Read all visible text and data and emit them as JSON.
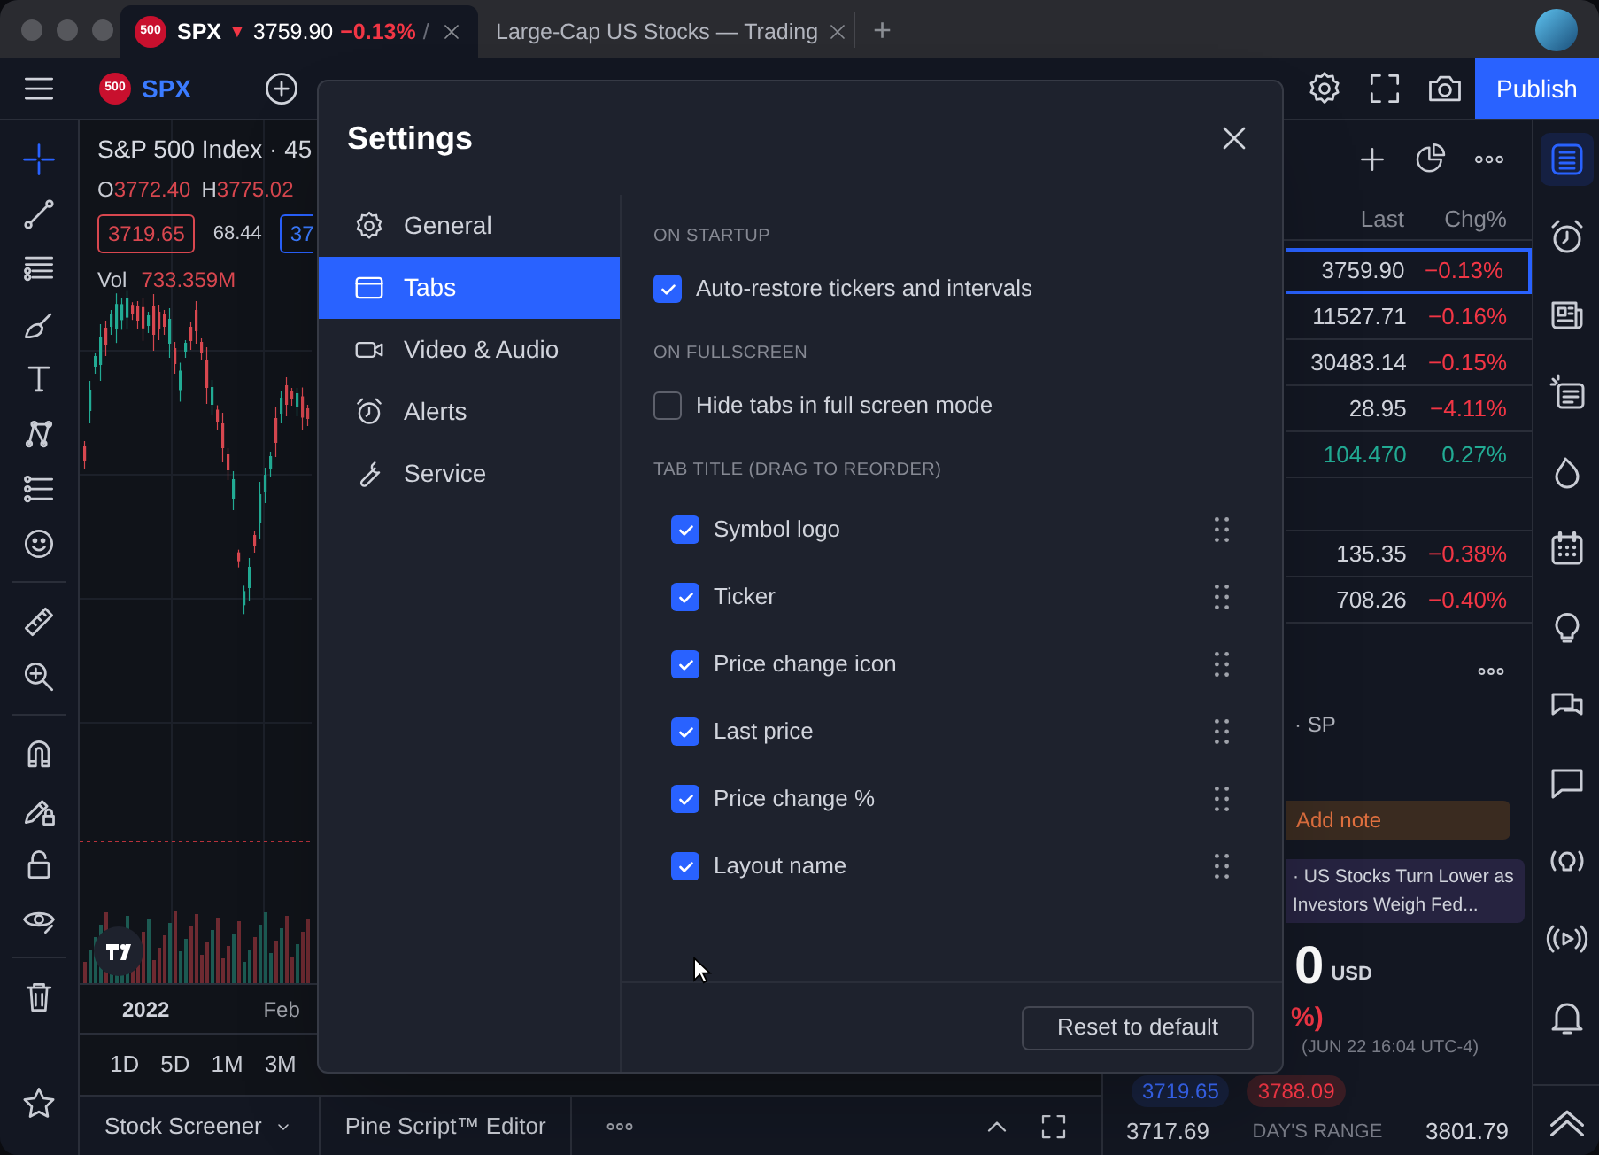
{
  "browser_tabs": [
    {
      "kind": "symbol",
      "logo": "500",
      "symbol": "SPX",
      "arrow": "▼",
      "price": "3759.90",
      "change": "−0.13%",
      "separator": "/",
      "selected": true
    },
    {
      "kind": "page",
      "title": "Large-Cap US Stocks — Trading",
      "selected": false
    }
  ],
  "new_tab": "+",
  "toolbar": {
    "logo": "500",
    "symbol": "SPX",
    "publish": "Publish"
  },
  "left_toolbar": {
    "tools": [
      {
        "selected": true
      },
      {
        "selected": false
      },
      {
        "selected": false
      },
      {
        "selected": false
      },
      {
        "selected": false
      },
      {
        "selected": false
      },
      {
        "selected": false
      },
      {
        "selected": false
      },
      {
        "selected": false
      },
      {
        "selected": false
      },
      {
        "selected": false
      },
      {
        "selected": false
      },
      {
        "selected": false
      },
      {
        "selected": false
      },
      {
        "selected": false
      },
      {
        "selected": false
      }
    ]
  },
  "chart": {
    "title": "S&P 500 Index · 45",
    "ohlc": [
      {
        "label": "O",
        "value": "3772.40"
      },
      {
        "label": "H",
        "value": "3775.02"
      }
    ],
    "sell_price": "3719.65",
    "spread": "68.44",
    "buy_price": "37",
    "volume_label": "Vol",
    "volume": "733.359M",
    "time_labels": [
      "2022",
      "Feb"
    ]
  },
  "timeframes": [
    "1D",
    "5D",
    "1M",
    "3M"
  ],
  "bottom_tabs": [
    {
      "label": "Stock Screener",
      "kind": "dropdown"
    },
    {
      "label": "Pine Script™ Editor",
      "kind": "plain"
    }
  ],
  "settings": {
    "title": "Settings",
    "nav": [
      {
        "label": "General",
        "selected": false
      },
      {
        "label": "Tabs",
        "selected": true
      },
      {
        "label": "Video & Audio",
        "selected": false
      },
      {
        "label": "Alerts",
        "selected": false
      },
      {
        "label": "Service",
        "selected": false
      }
    ],
    "sections": [
      {
        "heading": "ON STARTUP",
        "kind": "plain",
        "options": [
          {
            "label": "Auto-restore tickers and intervals",
            "checked": true
          }
        ]
      },
      {
        "heading": "ON FULLSCREEN",
        "kind": "plain",
        "options": [
          {
            "label": "Hide tabs in full screen mode",
            "checked": false
          }
        ]
      },
      {
        "heading": "TAB TITLE (DRAG TO REORDER)",
        "kind": "reorderable",
        "options": [
          {
            "label": "Symbol logo",
            "checked": true
          },
          {
            "label": "Ticker",
            "checked": true
          },
          {
            "label": "Price change icon",
            "checked": true
          },
          {
            "label": "Last price",
            "checked": true
          },
          {
            "label": "Price change %",
            "checked": true
          },
          {
            "label": "Layout name",
            "checked": true
          }
        ]
      }
    ],
    "reset": "Reset to default"
  },
  "watchlist": {
    "columns": [
      "Last",
      "Chg%"
    ],
    "rows": [
      {
        "kind": "symbol",
        "last": "3759.90",
        "change": "−0.13%",
        "color": "#f23645",
        "selected": true
      },
      {
        "kind": "symbol",
        "last": "11527.71",
        "change": "−0.16%",
        "color": "#f23645",
        "selected": false
      },
      {
        "kind": "symbol",
        "last": "30483.14",
        "change": "−0.15%",
        "color": "#f23645",
        "selected": false
      },
      {
        "kind": "symbol",
        "last": "28.95",
        "change": "−4.11%",
        "color": "#f23645",
        "selected": false
      },
      {
        "kind": "symbol",
        "last": "104.470",
        "change": "0.27%",
        "color": "#22ab94",
        "selected": false
      },
      {
        "kind": "section"
      },
      {
        "kind": "symbol",
        "last": "135.35",
        "change": "−0.38%",
        "color": "#f23645",
        "selected": false
      },
      {
        "kind": "symbol",
        "last": "708.26",
        "change": "−0.40%",
        "color": "#f23645",
        "selected": false
      }
    ]
  },
  "details": {
    "exchange": "· SP",
    "note": "Add note",
    "news": "· US Stocks Turn Lower as Investors Weigh Fed...",
    "price": "0",
    "currency": "USD",
    "change": "%)",
    "timestamp": "(JUN 22 16:04 UTC-4)",
    "bid": "3719.65",
    "ask": "3788.09",
    "range_low": "3717.69",
    "range_label": "DAY'S RANGE",
    "range_high": "3801.79"
  },
  "right_sidebar": {
    "items": [
      {
        "selected": true
      },
      {
        "selected": false
      },
      {
        "selected": false
      },
      {
        "selected": false
      },
      {
        "selected": false
      },
      {
        "selected": false
      },
      {
        "selected": false
      },
      {
        "selected": false
      },
      {
        "selected": false
      },
      {
        "selected": false
      },
      {
        "selected": false
      },
      {
        "selected": false
      }
    ]
  }
}
